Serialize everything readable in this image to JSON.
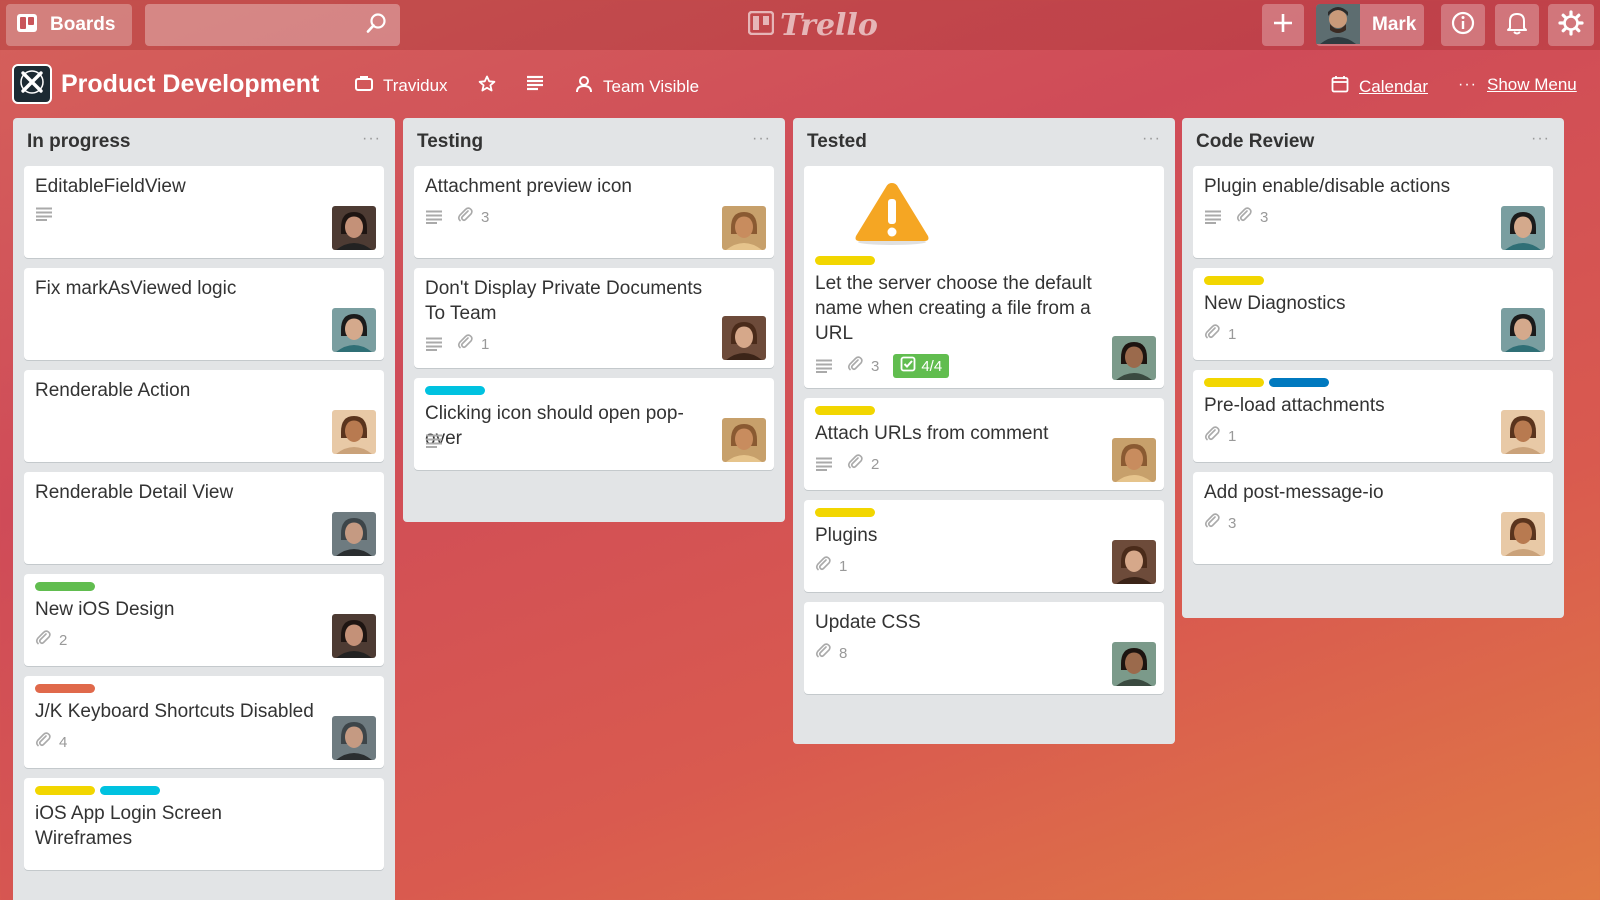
{
  "topbar": {
    "boards_label": "Boards",
    "search_value": "",
    "app_name": "Trello",
    "user_name": "Mark"
  },
  "board": {
    "title": "Product Development",
    "team": "Travidux",
    "visibility": "Team Visible",
    "calendar_label": "Calendar",
    "menu_label": "Show Menu"
  },
  "colors": {
    "label_green": "#61bd4f",
    "label_yellow": "#f2d600",
    "label_orange": "#e0694b",
    "label_sky": "#00c2e0",
    "label_blue": "#0079bf",
    "checklist_done": "#61bd4f"
  },
  "lists": [
    {
      "title": "In progress",
      "cards": [
        {
          "title": "EditableFieldView",
          "description": true,
          "labels": [],
          "attachments": "",
          "avatar": "face-dark-hair"
        },
        {
          "title": "Fix markAsViewed logic",
          "description": false,
          "labels": [],
          "attachments": "",
          "avatar": "face-teal-shirt"
        },
        {
          "title": "Renderable Action",
          "description": false,
          "labels": [],
          "attachments": "",
          "avatar": "face-woman-curly"
        },
        {
          "title": "Renderable Detail View",
          "description": false,
          "labels": [],
          "attachments": "",
          "avatar": "face-beanie"
        },
        {
          "title": "New iOS Design",
          "description": false,
          "labels": [
            "green"
          ],
          "attachments": "2",
          "avatar": "face-dark-hair"
        },
        {
          "title": "J/K Keyboard Shortcuts Disabled",
          "description": false,
          "labels": [
            "orange"
          ],
          "attachments": "4",
          "avatar": "face-beanie"
        },
        {
          "title": "iOS App Login Screen Wireframes",
          "description": false,
          "labels": [
            "yellow",
            "sky"
          ],
          "attachments": "",
          "avatar": ""
        }
      ]
    },
    {
      "title": "Testing",
      "cards": [
        {
          "title": "Attachment preview icon",
          "description": true,
          "labels": [],
          "attachments": "3",
          "avatar": "face-bald-glasses"
        },
        {
          "title": "Don't Display Private Documents To Team",
          "description": true,
          "labels": [],
          "attachments": "1",
          "avatar": "face-woman-brown"
        },
        {
          "title": "Clicking icon should open pop-over",
          "description": true,
          "labels": [
            "sky"
          ],
          "attachments": "",
          "avatar": "face-bald-glasses"
        }
      ]
    },
    {
      "title": "Tested",
      "cards": [
        {
          "title": "Let the server choose the default name when creating a file from a URL",
          "description": true,
          "labels": [
            "yellow"
          ],
          "attachments": "3",
          "checklist": "4/4",
          "avatar": "face-woman-dark",
          "cover_icon": "warning-icon"
        },
        {
          "title": "Attach URLs from comment",
          "description": true,
          "labels": [
            "yellow"
          ],
          "attachments": "2",
          "avatar": "face-bald-glasses"
        },
        {
          "title": "Plugins",
          "description": false,
          "labels": [
            "yellow"
          ],
          "attachments": "1",
          "avatar": "face-woman-brown"
        },
        {
          "title": "Update CSS",
          "description": false,
          "labels": [],
          "attachments": "8",
          "avatar": "face-woman-dark"
        }
      ]
    },
    {
      "title": "Code Review",
      "cards": [
        {
          "title": "Plugin enable/disable actions",
          "description": true,
          "labels": [],
          "attachments": "3",
          "avatar": "face-teal-shirt"
        },
        {
          "title": "New Diagnostics",
          "description": false,
          "labels": [
            "yellow"
          ],
          "attachments": "1",
          "avatar": "face-teal-shirt"
        },
        {
          "title": "Pre-load attachments",
          "description": false,
          "labels": [
            "yellow",
            "blue"
          ],
          "attachments": "1",
          "avatar": "face-woman-curly"
        },
        {
          "title": "Add post-message-io",
          "description": false,
          "labels": [],
          "attachments": "3",
          "avatar": "face-woman-curly"
        }
      ]
    }
  ]
}
